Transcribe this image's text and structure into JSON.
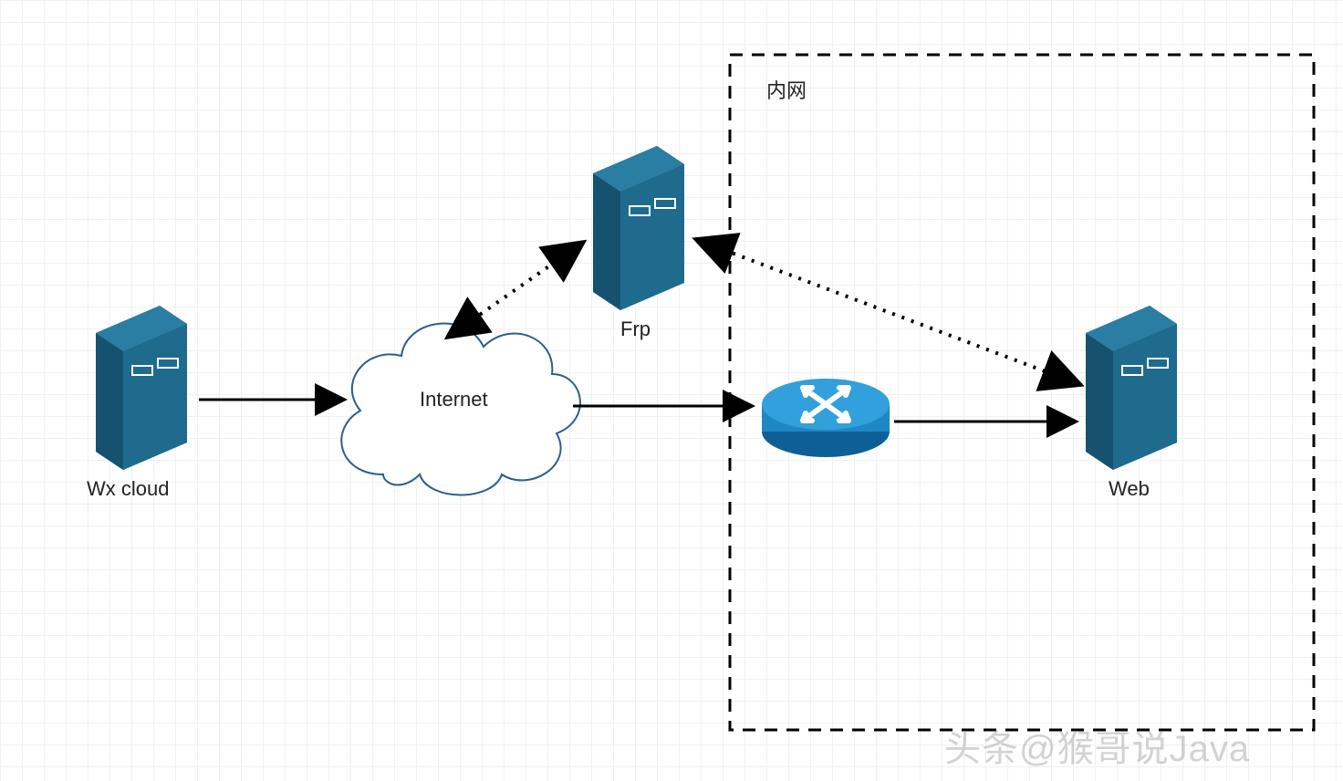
{
  "diagram": {
    "nodes": {
      "wx_cloud": {
        "label": "Wx cloud",
        "type": "server"
      },
      "internet": {
        "label": "Internet",
        "type": "cloud"
      },
      "frp": {
        "label": "Frp",
        "type": "server"
      },
      "router": {
        "label": "",
        "type": "router"
      },
      "web": {
        "label": "Web",
        "type": "server"
      }
    },
    "group": {
      "label": "内网",
      "contains": [
        "router",
        "web"
      ]
    },
    "edges": [
      {
        "from": "wx_cloud",
        "to": "internet",
        "style": "solid",
        "bidir": false
      },
      {
        "from": "internet",
        "to": "router",
        "style": "solid",
        "bidir": false
      },
      {
        "from": "router",
        "to": "web",
        "style": "solid",
        "bidir": false
      },
      {
        "from": "internet",
        "to": "frp",
        "style": "dotted",
        "bidir": true
      },
      {
        "from": "frp",
        "to": "web",
        "style": "dotted",
        "bidir": true
      }
    ],
    "colors": {
      "server_fill": "#1f6b8e",
      "router_fill": "#1e88c7",
      "stroke": "#000000",
      "cloud_stroke": "#2b5f8e"
    }
  },
  "watermark": "头条@猴哥说Java"
}
